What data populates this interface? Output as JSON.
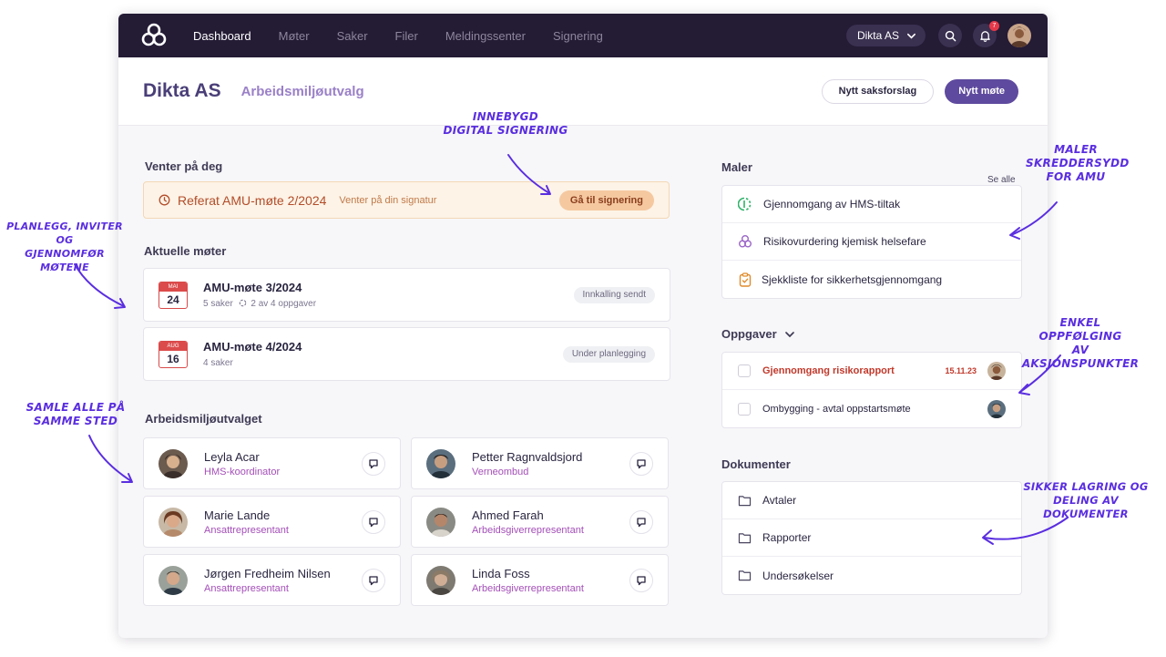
{
  "topbar": {
    "nav": [
      "Dashboard",
      "Møter",
      "Saker",
      "Filer",
      "Meldingssenter",
      "Signering"
    ],
    "org_select": "Dikta AS",
    "notification_count": "7"
  },
  "header": {
    "org": "Dikta AS",
    "committee": "Arbeidsmiljøutvalg",
    "new_case_button": "Nytt saksforslag",
    "new_meeting_button": "Nytt møte"
  },
  "waiting": {
    "section_title": "Venter på deg",
    "title": "Referat AMU-møte 2/2024",
    "subtitle": "Venter på din signatur",
    "button": "Gå til signering"
  },
  "meetings": {
    "section_title": "Aktuelle møter",
    "items": [
      {
        "month": "MAI",
        "day": "24",
        "title": "AMU-møte 3/2024",
        "meta_cases": "5 saker",
        "meta_tasks": "2 av 4 oppgaver",
        "status": "Innkalling sendt"
      },
      {
        "month": "AUG",
        "day": "16",
        "title": "AMU-møte 4/2024",
        "meta_cases": "4 saker",
        "meta_tasks": "",
        "status": "Under planlegging"
      }
    ]
  },
  "members": {
    "section_title": "Arbeidsmiljøutvalget",
    "items": [
      {
        "name": "Leyla Acar",
        "role": "HMS-koordinator"
      },
      {
        "name": "Petter Ragnvaldsjord",
        "role": "Verneombud"
      },
      {
        "name": "Marie Lande",
        "role": "Ansattrepresentant"
      },
      {
        "name": "Ahmed Farah",
        "role": "Arbeidsgiverrepresentant"
      },
      {
        "name": "Jørgen Fredheim Nilsen",
        "role": "Ansattrepresentant"
      },
      {
        "name": "Linda Foss",
        "role": "Arbeidsgiverrepresentant"
      }
    ]
  },
  "templates": {
    "section_title": "Maler",
    "see_all": "Se alle",
    "items": [
      {
        "label": "Gjennomgang av HMS-tiltak",
        "icon": "hms-icon",
        "color": "#2fb36a"
      },
      {
        "label": "Risikovurdering kjemisk helsefare",
        "icon": "molecule-icon",
        "color": "#9b66c8"
      },
      {
        "label": "Sjekkliste for sikkerhetsgjennomgang",
        "icon": "clipboard-icon",
        "color": "#e08a2a"
      }
    ]
  },
  "tasks": {
    "section_title": "Oppgaver",
    "items": [
      {
        "label": "Gjennomgang risikorapport",
        "date": "15.11.23",
        "overdue": true
      },
      {
        "label": "Ombygging - avtal oppstartsmøte",
        "date": "",
        "overdue": false
      }
    ]
  },
  "documents": {
    "section_title": "Dokumenter",
    "items": [
      "Avtaler",
      "Rapporter",
      "Undersøkelser"
    ]
  },
  "annotations": {
    "signing": [
      "INNEBYGD",
      "DIGITAL SIGNERING"
    ],
    "planning": [
      "PLANLEGG, INVITER OG",
      "GJENNOMFØR MØTENE"
    ],
    "gather": [
      "SAMLE ALLE PÅ",
      "SAMME STED"
    ],
    "templates": [
      "MALER",
      "SKREDDERSYDD",
      "FOR AMU"
    ],
    "followup": [
      "ENKEL OPPFØLGING",
      "AV AKSJONSPUNKTER"
    ],
    "storage": [
      "SIKKER LAGRING OG",
      "DELING AV DOKUMENTER"
    ]
  },
  "colors": {
    "topbar": "#241b35",
    "accent": "#5e4a9e",
    "annotation": "#5a2ee0",
    "overdue": "#c0392b"
  }
}
